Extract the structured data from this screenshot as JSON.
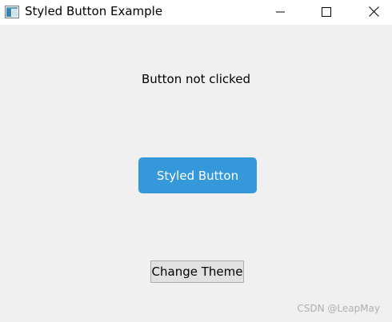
{
  "window": {
    "title": "Styled Button Example",
    "icon": "app-window-icon",
    "controls": {
      "minimize": "minimize-icon",
      "maximize": "maximize-icon",
      "close": "close-icon"
    }
  },
  "main": {
    "status_text": "Button not clicked",
    "styled_button_label": "Styled Button",
    "styled_button_color": "#3498db",
    "theme_button_label": "Change Theme",
    "background_color": "#f0f0f0"
  },
  "watermark": {
    "text": "CSDN @LeapMay"
  }
}
